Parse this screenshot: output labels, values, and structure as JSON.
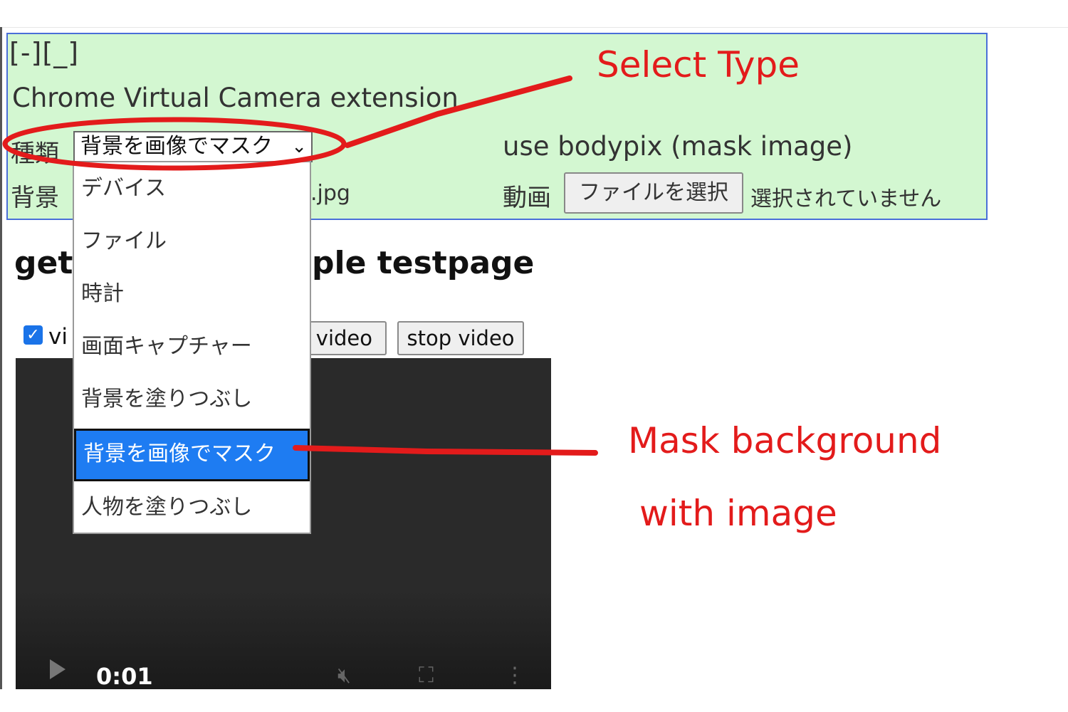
{
  "window": {
    "controls": "[-][_]"
  },
  "extension": {
    "title": "Chrome Virtual Camera extension",
    "type_label": "種類",
    "selected_type": "背景を画像でマスク",
    "background_label": "背景",
    "background_file_suffix": ".jpg",
    "mode_text": "use bodypix (mask image)",
    "video_label": "動画",
    "file_button": "ファイルを選択",
    "no_file_text": "選択されていません"
  },
  "dropdown": {
    "options": [
      {
        "label": "デバイス",
        "selected": false
      },
      {
        "label": "ファイル",
        "selected": false
      },
      {
        "label": "時計",
        "selected": false
      },
      {
        "label": "画面キャプチャー",
        "selected": false
      },
      {
        "label": "背景を塗りつぶし",
        "selected": false
      },
      {
        "label": "背景を画像でマスク",
        "selected": true
      },
      {
        "label": "人物を塗りつぶし",
        "selected": false
      }
    ]
  },
  "page": {
    "heading_left": "get",
    "heading_right": "ple testpage",
    "checkbox_label": "vi",
    "start_button": "t video",
    "stop_button": "stop video"
  },
  "player": {
    "time": "0:01"
  },
  "annotations": {
    "select_type": "Select Type",
    "mask_line1": "Mask background",
    "mask_line2": "with image",
    "color": "#e31b1b"
  },
  "colors": {
    "panel_bg": "#d3f7d1",
    "panel_border": "#4a6fd8",
    "highlight": "#1e7cf2"
  }
}
